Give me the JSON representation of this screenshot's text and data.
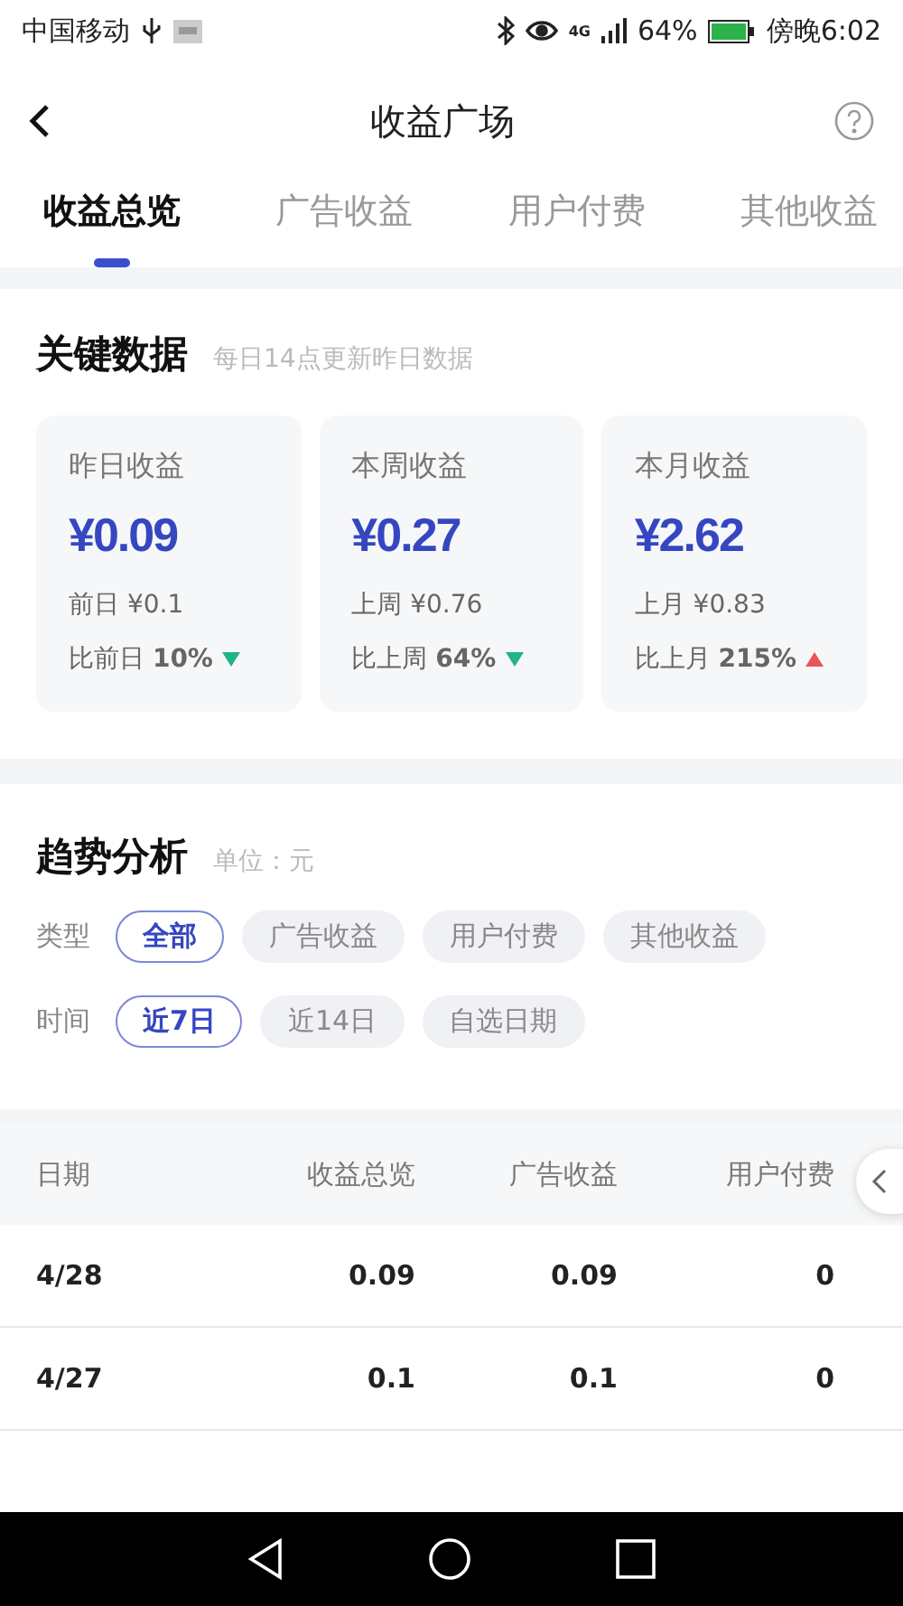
{
  "status_bar": {
    "carrier": "中国移动",
    "network": "4G",
    "battery": "64%",
    "time": "傍晚6:02"
  },
  "header": {
    "title": "收益广场"
  },
  "tabs": [
    {
      "label": "收益总览",
      "selected": true
    },
    {
      "label": "广告收益",
      "selected": false
    },
    {
      "label": "用户付费",
      "selected": false
    },
    {
      "label": "其他收益",
      "selected": false
    }
  ],
  "key_data": {
    "title": "关键数据",
    "note": "每日14点更新昨日数据",
    "cards": [
      {
        "label": "昨日收益",
        "value": "¥0.09",
        "previous": "前日 ¥0.1",
        "compare_label": "比前日",
        "compare_value": "10%",
        "kind": "down"
      },
      {
        "label": "本周收益",
        "value": "¥0.27",
        "previous": "上周 ¥0.76",
        "compare_label": "比上周",
        "compare_value": "64%",
        "kind": "down"
      },
      {
        "label": "本月收益",
        "value": "¥2.62",
        "previous": "上月 ¥0.83",
        "compare_label": "比上月",
        "compare_value": "215%",
        "kind": "up"
      }
    ]
  },
  "trend": {
    "title": "趋势分析",
    "unit": "单位：元",
    "filters": [
      {
        "label": "类型",
        "options": [
          {
            "label": "全部",
            "selected": true
          },
          {
            "label": "广告收益",
            "selected": false
          },
          {
            "label": "用户付费",
            "selected": false
          },
          {
            "label": "其他收益",
            "selected": false
          }
        ]
      },
      {
        "label": "时间",
        "options": [
          {
            "label": "近7日",
            "selected": true
          },
          {
            "label": "近14日",
            "selected": false
          },
          {
            "label": "自选日期",
            "selected": false
          }
        ]
      }
    ]
  },
  "table": {
    "columns": [
      "日期",
      "收益总览",
      "广告收益",
      "用户付费"
    ],
    "rows": [
      [
        "4/28",
        "0.09",
        "0.09",
        "0"
      ],
      [
        "4/27",
        "0.1",
        "0.1",
        "0"
      ]
    ]
  }
}
